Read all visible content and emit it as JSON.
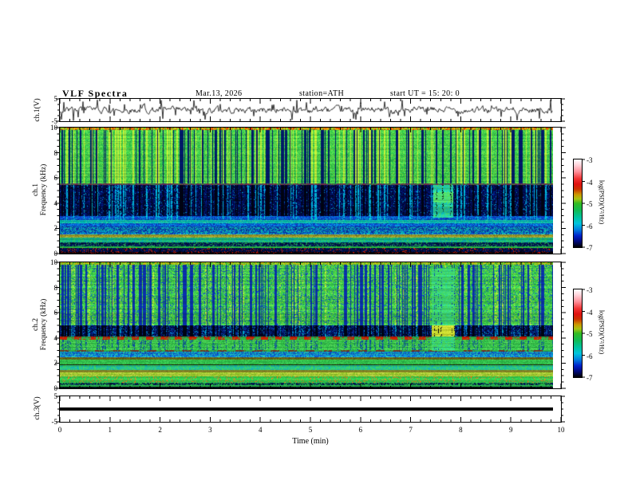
{
  "header": {
    "title": "VLF  Spectra",
    "date": "Mar.13, 2026",
    "station": "station=ATH",
    "start_ut": "start UT  =   15: 20: 0"
  },
  "axes": {
    "time": {
      "label": "Time  (min)",
      "tick_labels": [
        "0",
        "1",
        "2",
        "3",
        "4",
        "5",
        "6",
        "7",
        "8",
        "9",
        "10"
      ]
    },
    "freq_tick_labels": [
      "10",
      "8",
      "6",
      "4",
      "2",
      "0"
    ],
    "volt_top_label": "5",
    "volt_bottom_label": "-5"
  },
  "panels": {
    "ch1_wave": {
      "ylabel": "ch.1(V)"
    },
    "ch1_spec": {
      "ylabel_line1": "ch.1",
      "ylabel_line2": "Frequency  (kHz)"
    },
    "ch2_spec": {
      "ylabel_line1": "ch.2",
      "ylabel_line2": "Frequency  (kHz)"
    },
    "ch3_wave": {
      "ylabel": "ch.3(V)"
    }
  },
  "colorbar": {
    "label": "log(PSD)(V²/Hz)",
    "tick_labels": [
      "-3",
      "-4",
      "-5",
      "-6",
      "-7"
    ]
  },
  "chart_data": {
    "type": "heatmap",
    "title": "VLF Spectra",
    "date": "Mar.13, 2026",
    "station": "ATH",
    "start_ut": "15:20:0",
    "time_axis": {
      "label": "Time (min)",
      "range": [
        0,
        10
      ],
      "major_tick": 1,
      "minor_tick": 0.2,
      "data_end": 9.85
    },
    "freq_axis": {
      "range_khz": [
        0,
        10
      ],
      "major_tick": 2,
      "minor_tick": 0.5
    },
    "colorbar": {
      "range": [
        -7,
        -3
      ],
      "ticks": [
        -3,
        -4,
        -5,
        -6,
        -7
      ],
      "label": "log(PSD)(V²/Hz)",
      "stops_top_to_bottom": [
        [
          0.0,
          "#ffffff"
        ],
        [
          0.06,
          "#ffd6dd"
        ],
        [
          0.14,
          "#ff8f99"
        ],
        [
          0.22,
          "#f23333"
        ],
        [
          0.28,
          "#e01111"
        ],
        [
          0.34,
          "#cc3300"
        ],
        [
          0.4,
          "#cc9900"
        ],
        [
          0.45,
          "#a8c414"
        ],
        [
          0.5,
          "#33bb22"
        ],
        [
          0.58,
          "#11bb55"
        ],
        [
          0.66,
          "#00c4a0"
        ],
        [
          0.73,
          "#00c4dd"
        ],
        [
          0.8,
          "#0080e0"
        ],
        [
          0.87,
          "#0022cc"
        ],
        [
          0.93,
          "#000a80"
        ],
        [
          1.0,
          "#000000"
        ]
      ]
    },
    "ch1_waveform": {
      "units": "V",
      "ylim": [
        -5,
        5
      ],
      "baseline": 0,
      "noise_v": 0.5,
      "spike_count": 55,
      "spike_max_v": 4.8
    },
    "ch3_waveform": {
      "units": "V",
      "ylim": [
        -5,
        5
      ],
      "constant_value": 0,
      "line_thickness_px": 4
    },
    "ch1_spectrogram": {
      "streaks": {
        "dark": 150,
        "bright": 115
      },
      "bands": [
        {
          "f": [
            9.82,
            10.01
          ],
          "colors": [
            "#cc2200",
            "#ddaa00",
            "#33bb33",
            "#88cc22",
            "#dd6600"
          ]
        },
        {
          "f": [
            5.58,
            9.82
          ],
          "colors": [
            "#2fbf3f",
            "#3ecf4f",
            "#57d957",
            "#2bb24a",
            "#6fd943"
          ],
          "streakDark": "#001a66",
          "streakBright": "#b8e637"
        },
        {
          "f": [
            5.45,
            5.58
          ],
          "colors": [
            "#7a2f4f",
            "#8a3344",
            "#5a2f6f",
            "#2bb24a"
          ]
        },
        {
          "f": [
            3.0,
            5.45
          ],
          "colors": [
            "#000d4d",
            "#001166",
            "#00073d",
            "#001a80",
            "#000626"
          ],
          "speckle": {
            "c": "#0091cc",
            "p": 0.06
          },
          "streakDark": "#000312",
          "streakBright": "#00a8cc",
          "brightP": 0.85
        },
        {
          "f": [
            2.72,
            3.0
          ],
          "colors": [
            "#0a3fbf",
            "#0c56cc",
            "#0a2fa6",
            "#0091cc"
          ],
          "streakBright": "#00c4cc",
          "brightP": 0.6
        },
        {
          "f": [
            2.45,
            2.72
          ],
          "colors": [
            "#00b89e",
            "#00c4b8",
            "#2ecfa8",
            "#09a7c9"
          ]
        },
        {
          "f": [
            2.1,
            2.45
          ],
          "colors": [
            "#0a49cc",
            "#0a6fd9",
            "#0a35ad",
            "#00a0d9"
          ]
        },
        {
          "f": [
            1.58,
            2.1
          ],
          "colors": [
            "#0a49cc",
            "#00a0cc",
            "#0a2f99",
            "#13bfae"
          ]
        },
        {
          "f": [
            1.28,
            1.58
          ],
          "colors": [
            "#8f8f29",
            "#9c9c2e",
            "#7a7a20",
            "#a8a833"
          ]
        },
        {
          "f": [
            0.92,
            1.28
          ],
          "colors": [
            "#1fa863",
            "#00ad8f",
            "#2ebf5c",
            "#0a8fa0"
          ]
        },
        {
          "f": [
            0.62,
            0.92
          ],
          "colors": [
            "#001559",
            "#00246b",
            "#000d33",
            "#1f9e54"
          ]
        },
        {
          "f": [
            0.45,
            0.62
          ],
          "colors": [
            "#26bf40",
            "#2eb24a",
            "#1fa836"
          ]
        },
        {
          "f": [
            0.18,
            0.45
          ],
          "colors": [
            "#000d40",
            "#000522",
            "#001866"
          ],
          "speckle": {
            "c": "#cc2200",
            "p": 0.1
          }
        },
        {
          "f": [
            -0.01,
            0.18
          ],
          "colors": [
            "#000000",
            "#000311",
            "#200000"
          ],
          "speckle": {
            "c": "#bb1100",
            "p": 0.18
          }
        }
      ],
      "blobs": [
        {
          "t": [
            7.45,
            7.85
          ],
          "f": [
            2.9,
            5.5
          ],
          "colors": [
            "#2bbf8f",
            "#26cf9e",
            "#3ecf6b",
            "#09b8c9"
          ],
          "inner": {
            "f": [
              4.1,
              4.9
            ],
            "colors": [
              "#4fd96b",
              "#57e357",
              "#45d985"
            ]
          }
        }
      ]
    },
    "ch2_spectrogram": {
      "streaks": {
        "dark": 200,
        "bright": 55
      },
      "bands": [
        {
          "f": [
            9.82,
            10.01
          ],
          "colors": [
            "#88cc22",
            "#ddaa00",
            "#33bb33",
            "#bbdd33"
          ]
        },
        {
          "f": [
            5.0,
            9.82
          ],
          "colors": [
            "#2fbf3f",
            "#3ecf4f",
            "#49d957",
            "#29b24a",
            "#77d943"
          ],
          "speckle": {
            "c": "#0a49cc",
            "p": 0.1
          },
          "streakDark": "#0a2fa6",
          "streakBright": "#b8e637",
          "brightP": 0.4
        },
        {
          "f": [
            4.15,
            5.0
          ],
          "colors": [
            "#000d4d",
            "#001a73",
            "#000729",
            "#0a2f99"
          ],
          "speckle": {
            "c": "#00a0cc",
            "p": 0.08
          },
          "streakDark": "#000312",
          "streakBright": "#00a0cc",
          "brightP": 0.5
        },
        {
          "f": [
            3.92,
            4.15
          ],
          "type": "dash",
          "period": 9,
          "colors": [
            "#cc1f00",
            "#2bb24a"
          ]
        },
        {
          "f": [
            3.1,
            3.92
          ],
          "colors": [
            "#2fbf46",
            "#3ecf4f",
            "#26a843",
            "#57cf57"
          ],
          "streakDark": "#0a49a0",
          "darkP": 0.5
        },
        {
          "f": [
            2.92,
            3.1
          ],
          "type": "dash",
          "period": 11,
          "colors": [
            "#7a3320",
            "#2bb24a"
          ]
        },
        {
          "f": [
            2.5,
            2.92
          ],
          "colors": [
            "#09a0cc",
            "#0a6fcc",
            "#26bfa8",
            "#0a49bf"
          ]
        },
        {
          "f": [
            2.32,
            2.5
          ],
          "colors": [
            "#6b6b1a",
            "#7a7a20",
            "#5c5c14"
          ]
        },
        {
          "f": [
            1.96,
            2.32
          ],
          "colors": [
            "#2fbf46",
            "#3ecf57",
            "#29a843"
          ]
        },
        {
          "f": [
            1.85,
            1.96
          ],
          "colors": [
            "#1a1a00",
            "#2e2e0a",
            "#0d2606"
          ]
        },
        {
          "f": [
            1.5,
            1.85
          ],
          "colors": [
            "#2bbf6b",
            "#26b28f",
            "#3ecf57",
            "#0fa7b0"
          ]
        },
        {
          "f": [
            1.28,
            1.5
          ],
          "colors": [
            "#8f8f29",
            "#9c9c2e",
            "#858523"
          ]
        },
        {
          "f": [
            0.98,
            1.28
          ],
          "colors": [
            "#a0cf2e",
            "#b8d93d",
            "#8fc926",
            "#cfe34d"
          ]
        },
        {
          "f": [
            0.5,
            0.98
          ],
          "colors": [
            "#2bb24a",
            "#2fbf3f",
            "#33cc55"
          ],
          "speckle": {
            "c": "#e07a1a",
            "p": 0.12
          }
        },
        {
          "f": [
            0.3,
            0.5
          ],
          "colors": [
            "#001040",
            "#001a66",
            "#1f9e54"
          ],
          "speckle": {
            "c": "#26bf40",
            "p": 0.2
          }
        },
        {
          "f": [
            0.14,
            0.3
          ],
          "colors": [
            "#26b246",
            "#2bbf57"
          ]
        },
        {
          "f": [
            -0.01,
            0.14
          ],
          "colors": [
            "#000000",
            "#000d26"
          ]
        }
      ],
      "blobs": [
        {
          "t": [
            7.42,
            7.88
          ],
          "f": [
            3.0,
            9.6
          ],
          "colors": [
            "#3ecf57",
            "#49d96b",
            "#2fcf8f"
          ],
          "inner": {
            "f": [
              4.15,
              5.0
            ],
            "colors": [
              "#c9d92e",
              "#b8cf26",
              "#d9e33d"
            ]
          }
        }
      ]
    }
  }
}
